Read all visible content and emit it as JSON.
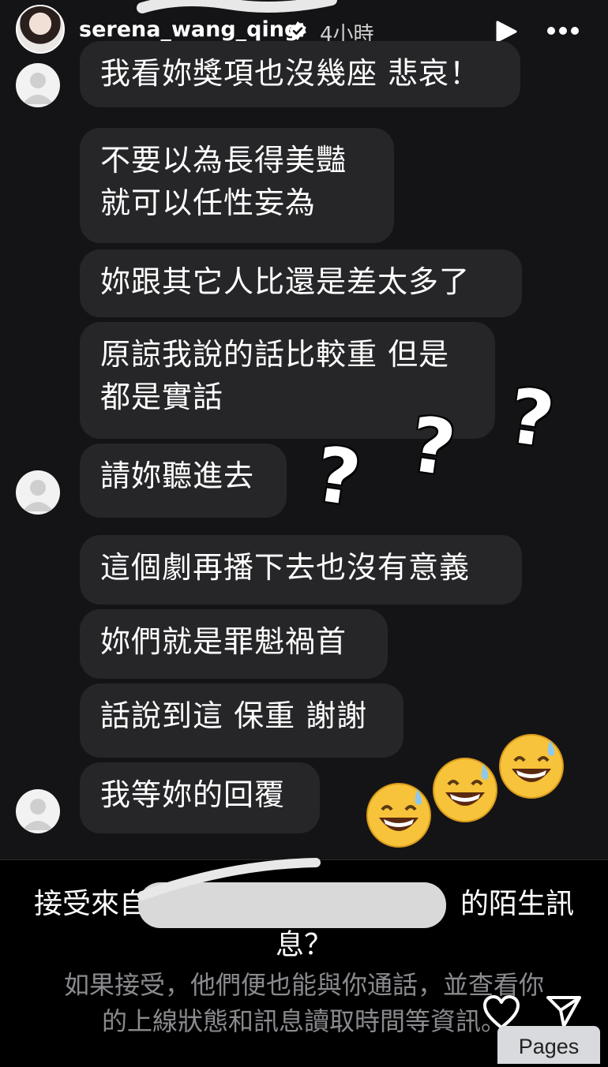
{
  "story": {
    "username": "serena_wang_qing",
    "time_ago": "4小時",
    "icons": [
      "verified-badge-icon",
      "play-icon",
      "more-icon"
    ]
  },
  "messages": [
    {
      "text": "我看妳獎項也沒幾座 悲哀！"
    },
    {
      "text": "不要以為長得美豔\n就可以任性妄為"
    },
    {
      "text": "妳跟其它人比還是差太多了"
    },
    {
      "text": "原諒我說的話比較重 但是\n都是實話"
    },
    {
      "text": "請妳聽進去"
    },
    {
      "text": "這個劇再播下去也沒有意義"
    },
    {
      "text": "妳們就是罪魁禍首"
    },
    {
      "text": "話說到這 保重 謝謝"
    },
    {
      "text": "我等妳的回覆"
    }
  ],
  "stickers": {
    "question_mark": "?",
    "sweat_smile": "sweat-smile-emoji"
  },
  "request": {
    "title_left": "接受來自",
    "title_right": "）的陌生訊",
    "title_line2": "息？",
    "description_line1": "如果接受，他們便也能與你通話，並查看你",
    "description_line2": "的上線狀態和訊息讀取時間等資訊。"
  },
  "footer": {
    "pages_label": "Pages",
    "icons": [
      "heart-icon",
      "send-icon"
    ]
  },
  "colors": {
    "background": "#141416",
    "bubble": "#262628",
    "secondary_text": "#8a8a8e"
  }
}
